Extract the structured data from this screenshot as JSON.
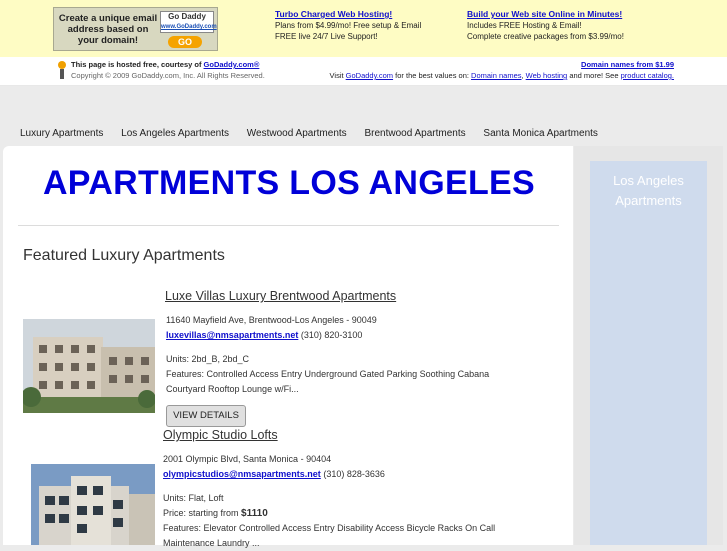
{
  "banner": {
    "ad_text": "Create a unique email address based on your domain!",
    "logo_text": "Go Daddy",
    "logo_url": "www.GoDaddy.com",
    "go_label": "GO",
    "promo1": {
      "title": "Turbo Charged Web Hosting!",
      "line1": "Plans from $4.99/mo! Free setup & Email",
      "line2": "FREE live 24/7 Live Support!"
    },
    "promo2": {
      "title": "Build your Web site Online in Minutes!",
      "line1": "Includes FREE Hosting & Email!",
      "line2": "Complete creative packages from $3.99/mo!"
    }
  },
  "hosting": {
    "line1_prefix": "This page is hosted free, courtesy of",
    "line1_link": "GoDaddy.com®",
    "line2": "Copyright © 2009 GoDaddy.com, Inc. All Rights Reserved.",
    "right1": "Domain names from $1.99",
    "right2_prefix": "Visit",
    "right2_link1": "GoDaddy.com",
    "right2_mid": "for the best values on:",
    "right2_link2": "Domain names",
    "right2_link3": "Web hosting",
    "right2_mid2": "and more! See",
    "right2_link4": "product catalog."
  },
  "nav": [
    "Luxury Apartments",
    "Los Angeles Apartments",
    "Westwood Apartments",
    "Brentwood Apartments",
    "Santa Monica Apartments"
  ],
  "main": {
    "title": "APARTMENTS LOS ANGELES",
    "featured": "Featured Luxury Apartments"
  },
  "sidebar": {
    "title": "Los Angeles Apartments"
  },
  "listings": [
    {
      "title": "Luxe Villas Luxury Brentwood Apartments",
      "address": "11640 Mayfield Ave, Brentwood-Los Angeles - 90049",
      "email": "luxevillas@nmsapartments.net",
      "phone": "(310) 820-3100",
      "units": "Units: 2bd_B, 2bd_C",
      "features": "Features: Controlled Access Entry Underground Gated Parking Soothing Cabana Courtyard Rooftop Lounge w/Fi...",
      "button": "VIEW DETAILS"
    },
    {
      "title": "Olympic Studio Lofts",
      "address": "2001 Olympic Blvd, Santa Monica - 90404",
      "email": "olympicstudios@nmsapartments.net",
      "phone": "(310) 828-3636",
      "units": "Units: Flat, Loft",
      "price_prefix": "Price: starting from",
      "price": "$1110",
      "features": "Features: Elevator Controlled Access Entry Disability Access Bicycle Racks On Call Maintenance Laundry ..."
    }
  ]
}
